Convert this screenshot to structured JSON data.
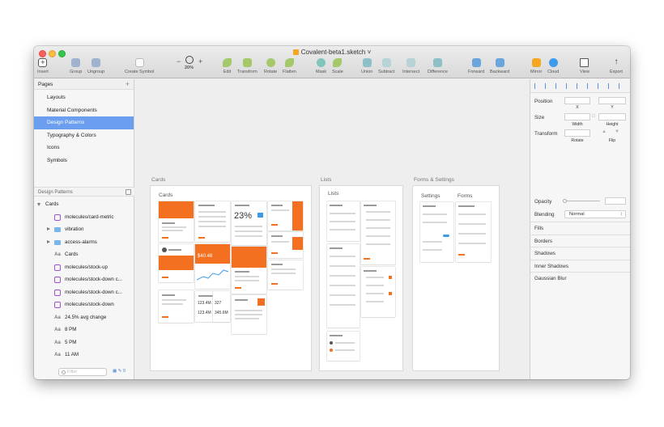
{
  "window": {
    "title": "Covalent-beta1.sketch",
    "title_suffix": "˅"
  },
  "toolbar": {
    "insert": "Insert",
    "group": "Group",
    "ungroup": "Ungroup",
    "create_symbol": "Create Symbol",
    "zoom_minus": "−",
    "zoom_plus": "+",
    "zoom_level": "20%",
    "edit": "Edit",
    "transform": "Transform",
    "rotate": "Rotate",
    "flatten": "Flatten",
    "mask": "Mask",
    "scale": "Scale",
    "union": "Union",
    "subtract": "Subtract",
    "intersect": "Intersect",
    "difference": "Difference",
    "forward": "Forward",
    "backward": "Backward",
    "mirror": "Mirror",
    "cloud": "Cloud",
    "view": "View",
    "export": "Export"
  },
  "pages": {
    "header": "Pages",
    "add": "+",
    "items": [
      {
        "label": "Layouts",
        "selected": false
      },
      {
        "label": "Material Components",
        "selected": false
      },
      {
        "label": "Design Patterns",
        "selected": true
      },
      {
        "label": "Typography & Colors",
        "selected": false
      },
      {
        "label": "Icons",
        "selected": false
      },
      {
        "label": "Symbols",
        "selected": false
      }
    ]
  },
  "layers": {
    "header": "Design Patterns",
    "items": [
      {
        "label": "Cards",
        "type": "artboard"
      },
      {
        "label": "molecules/card-metric",
        "type": "symbol"
      },
      {
        "label": "vibration",
        "type": "folder"
      },
      {
        "label": "access-alarms",
        "type": "folder"
      },
      {
        "label": "Cards",
        "type": "text"
      },
      {
        "label": "molecules/stock-up",
        "type": "symbol"
      },
      {
        "label": "molecules/stock-down c...",
        "type": "symbol"
      },
      {
        "label": "molecules/stock-down c...",
        "type": "symbol"
      },
      {
        "label": "molecules/stock-down",
        "type": "symbol"
      },
      {
        "label": "24.5% avg change",
        "type": "text"
      },
      {
        "label": "8 PM",
        "type": "text"
      },
      {
        "label": "5 PM",
        "type": "text"
      },
      {
        "label": "11 AM",
        "type": "text"
      }
    ],
    "filter_placeholder": "Filter",
    "count": "0"
  },
  "canvas": {
    "artboards": [
      {
        "name": "Cards",
        "title": "Cards"
      },
      {
        "name": "Lists",
        "title": "Lists"
      },
      {
        "name": "Forms & Settings",
        "subtitles": [
          "Settings",
          "Forms"
        ]
      }
    ],
    "card_texts": {
      "metric": "23%",
      "val1": "$40.48",
      "val2": "123.4M",
      "val3": "327",
      "val4": "123.4M",
      "val5": "345.6M"
    }
  },
  "inspector": {
    "position": "Position",
    "x_label": "X",
    "y_label": "Y",
    "size": "Size",
    "width_label": "Width",
    "height_label": "Height",
    "transform": "Transform",
    "rotate_label": "Rotate",
    "flip_label": "Flip",
    "opacity": "Opacity",
    "blending": "Blending",
    "blending_value": "Normal",
    "sections": [
      "Fills",
      "Borders",
      "Shadows",
      "Inner Shadows",
      "Gaussian Blur"
    ]
  },
  "colors": {
    "accent_orange": "#f37021",
    "selection_blue": "#6b9eee",
    "symbol_purple": "#a050d8"
  }
}
